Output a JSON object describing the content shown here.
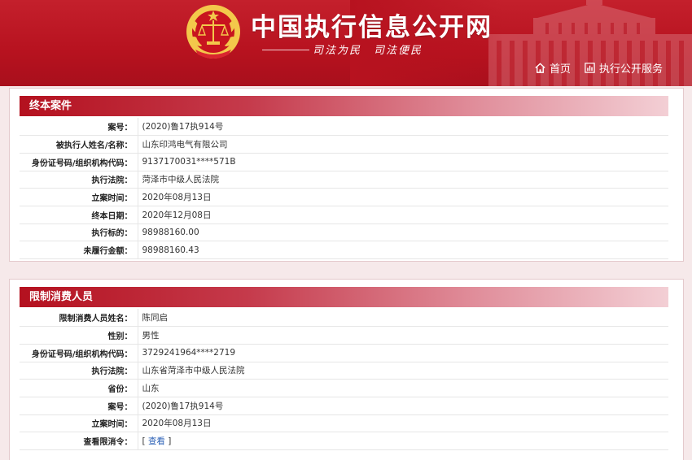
{
  "header": {
    "site_title": "中国执行信息公开网",
    "slogan": "司法为民　司法便民",
    "nav": [
      {
        "label": "首页",
        "icon": "home-icon"
      },
      {
        "label": "执行公开服务",
        "icon": "chart-icon"
      }
    ]
  },
  "closed_case": {
    "title": "终本案件",
    "rows": [
      {
        "label": "案号：",
        "value": "(2020)鲁17执914号"
      },
      {
        "label": "被执行人姓名/名称：",
        "value": "山东印鸿电气有限公司"
      },
      {
        "label": "身份证号码/组织机构代码：",
        "value": "9137170031****571B"
      },
      {
        "label": "执行法院：",
        "value": "菏泽市中级人民法院"
      },
      {
        "label": "立案时间：",
        "value": "2020年08月13日"
      },
      {
        "label": "终本日期：",
        "value": "2020年12月08日"
      },
      {
        "label": "执行标的：",
        "value": "98988160.00"
      },
      {
        "label": "未履行金额：",
        "value": "98988160.43"
      }
    ]
  },
  "restricted_person": {
    "title": "限制消费人员",
    "rows": [
      {
        "label": "限制消费人员姓名：",
        "value": "陈同启"
      },
      {
        "label": "性别：",
        "value": "男性"
      },
      {
        "label": "身份证号码/组织机构代码：",
        "value": "3729241964****2719"
      },
      {
        "label": "执行法院：",
        "value": "山东省菏泽市中级人民法院"
      },
      {
        "label": "省份：",
        "value": "山东"
      },
      {
        "label": "案号：",
        "value": "(2020)鲁17执914号"
      },
      {
        "label": "立案时间：",
        "value": "2020年08月13日"
      }
    ],
    "order_row": {
      "label": "查看限消令：",
      "bracket_open": "[ ",
      "link_text": "查看",
      "bracket_close": " ]"
    }
  },
  "colors": {
    "header_red": "#b7121f",
    "panel_header_red": "#b4111f",
    "link_blue": "#2a5fb5",
    "page_background": "#f6e9ea"
  }
}
